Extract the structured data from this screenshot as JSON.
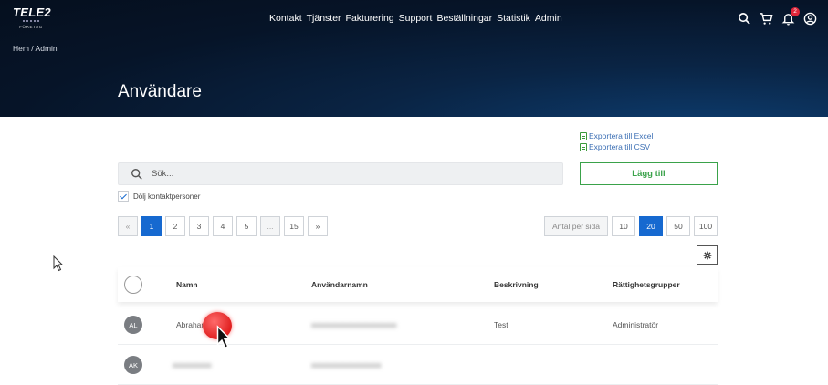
{
  "header": {
    "logo_main": "TELE2",
    "logo_sub": "FÖRETAG",
    "nav": [
      "Kontakt",
      "Tjänster",
      "Fakturering",
      "Support",
      "Beställningar",
      "Statistik",
      "Admin"
    ],
    "notification_count": "2",
    "breadcrumb": "Hem  /  Admin",
    "page_title": "Användare"
  },
  "exports": {
    "excel": "Exportera till Excel",
    "csv": "Exportera till CSV"
  },
  "search": {
    "placeholder": "Sök..."
  },
  "add_button": "Lägg till",
  "hide_contacts": {
    "label": "Dölj kontaktpersoner",
    "checked": true
  },
  "pagination": {
    "prev": "«",
    "pages": [
      "1",
      "2",
      "3",
      "4",
      "5",
      "...",
      "15"
    ],
    "next": "»",
    "current": "1"
  },
  "per_page": {
    "label": "Antal per sida",
    "options": [
      "10",
      "20",
      "50",
      "100"
    ],
    "selected": "20"
  },
  "table": {
    "columns": [
      "Namn",
      "Användarnamn",
      "Beskrivning",
      "Rättighetsgrupper"
    ],
    "rows": [
      {
        "initials": "AL",
        "name": "Abraham",
        "username": "",
        "description": "Test",
        "groups": "Administratör"
      },
      {
        "initials": "AK",
        "name": "",
        "username": "",
        "description": "",
        "groups": ""
      }
    ]
  },
  "colors": {
    "accent_blue": "#1669d0",
    "add_green": "#3aa24a",
    "badge_red": "#e0263a",
    "hero_dark": "#061428"
  }
}
